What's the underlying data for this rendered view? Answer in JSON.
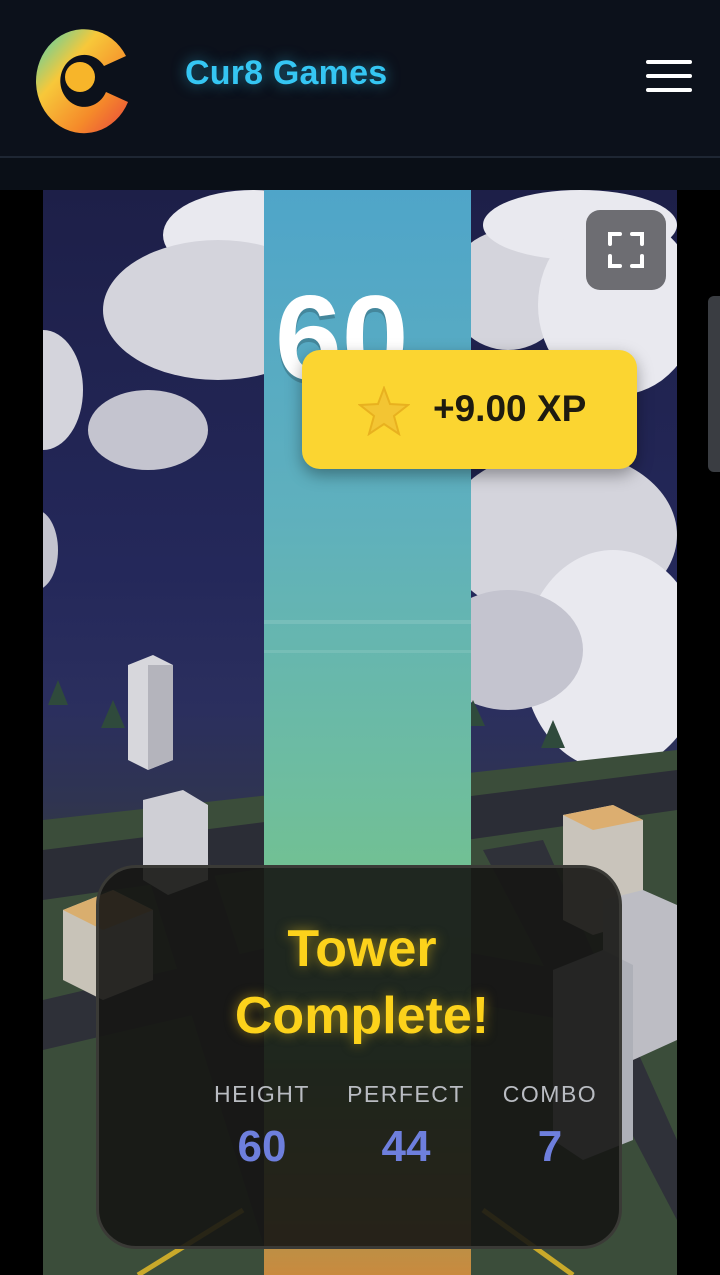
{
  "header": {
    "brand": "Cur8 Games",
    "logo_icon": "cur8-logo-icon",
    "menu_icon": "hamburger-menu-icon"
  },
  "game": {
    "score": "60",
    "fullscreen_icon": "fullscreen-icon",
    "xp_toast": {
      "icon": "star-icon",
      "label": "+9.00 XP"
    },
    "result": {
      "title_line1": "Tower",
      "title_line2": "Complete!",
      "stats": [
        {
          "label": "HEIGHT",
          "value": "60"
        },
        {
          "label": "PERFECT",
          "value": "44"
        },
        {
          "label": "COMBO",
          "value": "7"
        }
      ]
    }
  },
  "colors": {
    "brand": "#35c6f3",
    "xp_bg": "#fbd531",
    "title": "#fcd21b",
    "stat_value": "#6e7fdd"
  }
}
